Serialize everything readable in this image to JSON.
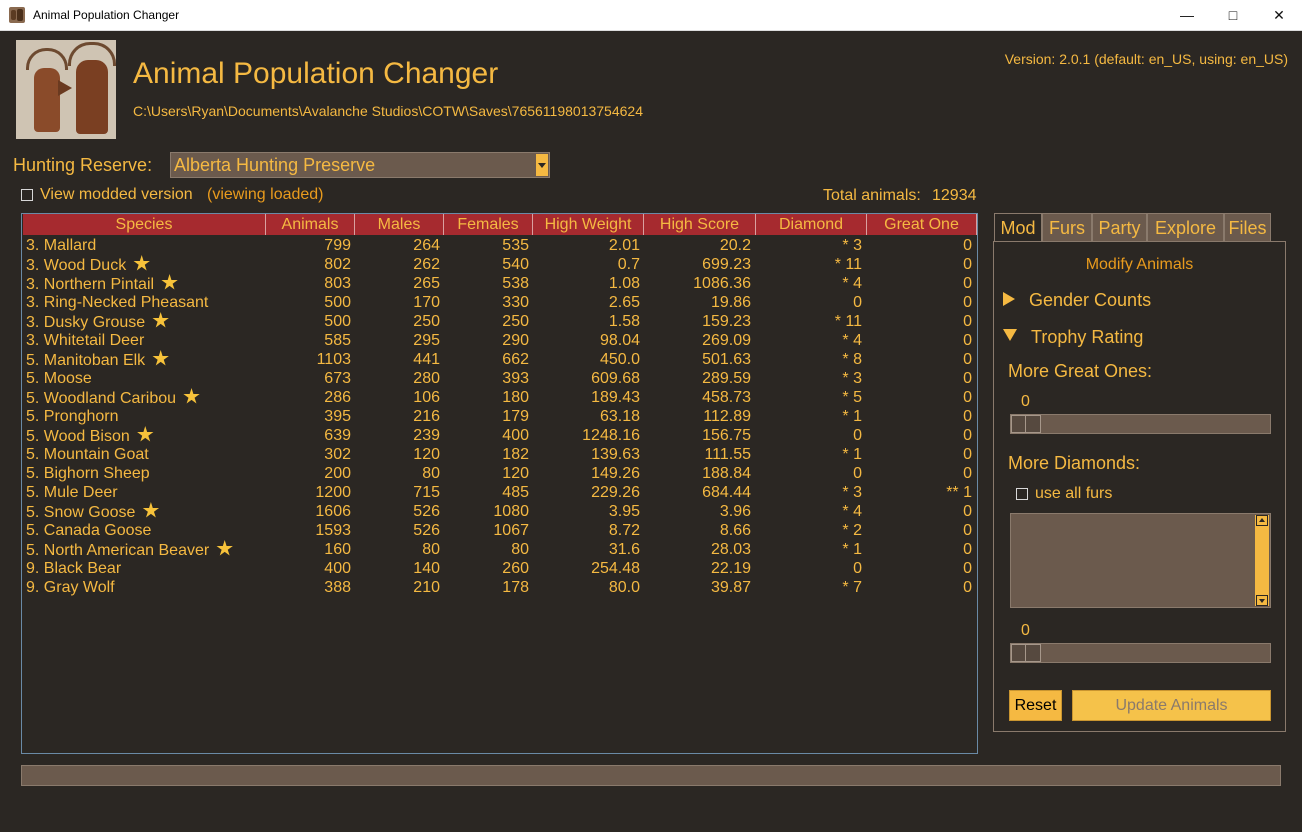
{
  "window": {
    "title": "Animal Population Changer"
  },
  "header": {
    "title": "Animal Population Changer",
    "path": "C:\\Users\\Ryan\\Documents\\Avalanche Studios\\COTW\\Saves\\76561198013754624",
    "version": "Version: 2.0.1 (default: en_US, using: en_US)"
  },
  "reserve": {
    "label": "Hunting Reserve:",
    "value": "Alberta Hunting Preserve"
  },
  "modded": {
    "label": "View modded version",
    "status": "(viewing loaded)",
    "checked": false
  },
  "total": {
    "label": "Total animals:",
    "value": "12934"
  },
  "table": {
    "columns": [
      "Species",
      "Animals",
      "Males",
      "Females",
      "High Weight",
      "High Score",
      "Diamond",
      "Great One"
    ],
    "rows": [
      {
        "species": "3. Mallard",
        "star": false,
        "animals": "799",
        "males": "264",
        "females": "535",
        "weight": "2.01",
        "score": "20.2",
        "diamond": "* 3",
        "great": "0"
      },
      {
        "species": "3. Wood Duck",
        "star": true,
        "animals": "802",
        "males": "262",
        "females": "540",
        "weight": "0.7",
        "score": "699.23",
        "diamond": "* 11",
        "great": "0"
      },
      {
        "species": "3. Northern Pintail",
        "star": true,
        "animals": "803",
        "males": "265",
        "females": "538",
        "weight": "1.08",
        "score": "1086.36",
        "diamond": "* 4",
        "great": "0"
      },
      {
        "species": "3. Ring-Necked Pheasant",
        "star": false,
        "animals": "500",
        "males": "170",
        "females": "330",
        "weight": "2.65",
        "score": "19.86",
        "diamond": "0",
        "great": "0"
      },
      {
        "species": "3. Dusky Grouse",
        "star": true,
        "animals": "500",
        "males": "250",
        "females": "250",
        "weight": "1.58",
        "score": "159.23",
        "diamond": "* 11",
        "great": "0"
      },
      {
        "species": "3. Whitetail Deer",
        "star": false,
        "animals": "585",
        "males": "295",
        "females": "290",
        "weight": "98.04",
        "score": "269.09",
        "diamond": "* 4",
        "great": "0"
      },
      {
        "species": "5. Manitoban Elk",
        "star": true,
        "animals": "1103",
        "males": "441",
        "females": "662",
        "weight": "450.0",
        "score": "501.63",
        "diamond": "* 8",
        "great": "0"
      },
      {
        "species": "5. Moose",
        "star": false,
        "animals": "673",
        "males": "280",
        "females": "393",
        "weight": "609.68",
        "score": "289.59",
        "diamond": "* 3",
        "great": "0"
      },
      {
        "species": "5. Woodland Caribou",
        "star": true,
        "animals": "286",
        "males": "106",
        "females": "180",
        "weight": "189.43",
        "score": "458.73",
        "diamond": "* 5",
        "great": "0"
      },
      {
        "species": "5. Pronghorn",
        "star": false,
        "animals": "395",
        "males": "216",
        "females": "179",
        "weight": "63.18",
        "score": "112.89",
        "diamond": "* 1",
        "great": "0"
      },
      {
        "species": "5. Wood Bison",
        "star": true,
        "animals": "639",
        "males": "239",
        "females": "400",
        "weight": "1248.16",
        "score": "156.75",
        "diamond": "0",
        "great": "0"
      },
      {
        "species": "5. Mountain Goat",
        "star": false,
        "animals": "302",
        "males": "120",
        "females": "182",
        "weight": "139.63",
        "score": "111.55",
        "diamond": "* 1",
        "great": "0"
      },
      {
        "species": "5. Bighorn Sheep",
        "star": false,
        "animals": "200",
        "males": "80",
        "females": "120",
        "weight": "149.26",
        "score": "188.84",
        "diamond": "0",
        "great": "0"
      },
      {
        "species": "5. Mule Deer",
        "star": false,
        "animals": "1200",
        "males": "715",
        "females": "485",
        "weight": "229.26",
        "score": "684.44",
        "diamond": "* 3",
        "great": "** 1"
      },
      {
        "species": "5. Snow Goose",
        "star": true,
        "animals": "1606",
        "males": "526",
        "females": "1080",
        "weight": "3.95",
        "score": "3.96",
        "diamond": "* 4",
        "great": "0"
      },
      {
        "species": "5. Canada Goose",
        "star": false,
        "animals": "1593",
        "males": "526",
        "females": "1067",
        "weight": "8.72",
        "score": "8.66",
        "diamond": "* 2",
        "great": "0"
      },
      {
        "species": "5. North American Beaver",
        "star": true,
        "animals": "160",
        "males": "80",
        "females": "80",
        "weight": "31.6",
        "score": "28.03",
        "diamond": "* 1",
        "great": "0"
      },
      {
        "species": "9. Black Bear",
        "star": false,
        "animals": "400",
        "males": "140",
        "females": "260",
        "weight": "254.48",
        "score": "22.19",
        "diamond": "0",
        "great": "0"
      },
      {
        "species": "9. Gray Wolf",
        "star": false,
        "animals": "388",
        "males": "210",
        "females": "178",
        "weight": "80.0",
        "score": "39.87",
        "diamond": "* 7",
        "great": "0"
      }
    ]
  },
  "tabs": [
    {
      "label": "Mod",
      "active": true
    },
    {
      "label": "Furs",
      "active": false
    },
    {
      "label": "Party",
      "active": false
    },
    {
      "label": "Explore",
      "active": false
    },
    {
      "label": "Files",
      "active": false
    }
  ],
  "mod_panel": {
    "heading": "Modify Animals",
    "gender_counts": "Gender Counts",
    "trophy_rating": "Trophy Rating",
    "more_great_ones": "More Great Ones:",
    "great_ones_value": "0",
    "more_diamonds": "More Diamonds:",
    "use_all_furs": "use all furs",
    "use_all_furs_checked": false,
    "diamonds_value": "0",
    "reset": "Reset",
    "update": "Update Animals"
  },
  "colors": {
    "background": "#2b2723",
    "accent": "#f5b942",
    "header_red": "#a62a2f",
    "field": "#6b5a4d"
  }
}
